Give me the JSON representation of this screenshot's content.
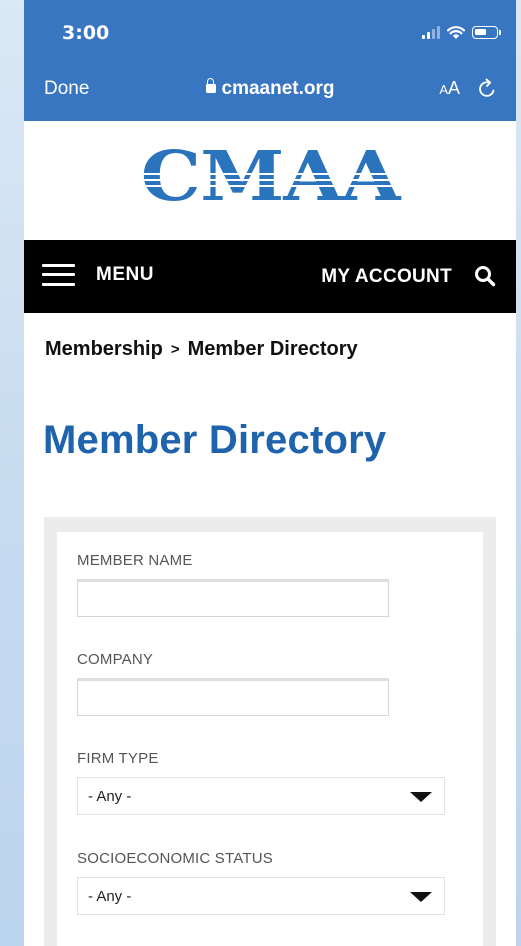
{
  "status": {
    "time": "3:00"
  },
  "browser": {
    "done_label": "Done",
    "url": "cmaanet.org",
    "text_size_big": "A",
    "text_size_small": "A"
  },
  "site": {
    "logo": "CMAA"
  },
  "nav": {
    "menu_label": "MENU",
    "account_label": "MY ACCOUNT"
  },
  "breadcrumb": {
    "items": [
      "Membership",
      "Member Directory"
    ],
    "separator": ">"
  },
  "page": {
    "title": "Member Directory"
  },
  "form": {
    "member_name": {
      "label": "MEMBER NAME",
      "value": ""
    },
    "company": {
      "label": "COMPANY",
      "value": ""
    },
    "firm_type": {
      "label": "FIRM TYPE",
      "selected": "- Any -"
    },
    "socioeconomic_status": {
      "label": "SOCIOECONOMIC STATUS",
      "selected": "- Any -"
    }
  },
  "colors": {
    "browser_bar": "#3976c2",
    "logo": "#2a73bd",
    "title": "#1f63ad",
    "nav_bg": "#000000"
  }
}
